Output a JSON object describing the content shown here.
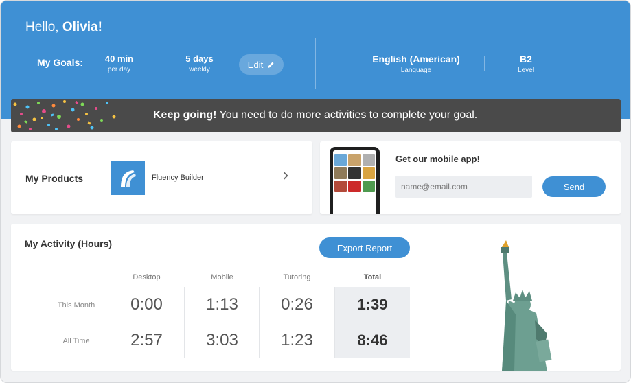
{
  "header": {
    "greeting_prefix": "Hello,",
    "user_name": "Olivia!"
  },
  "goals": {
    "label": "My Goals:",
    "time_value": "40 min",
    "time_sub": "per day",
    "days_value": "5 days",
    "days_sub": "weekly",
    "edit_label": "Edit",
    "language_value": "English (American)",
    "language_sub": "Language",
    "level_value": "B2",
    "level_sub": "Level"
  },
  "banner": {
    "bold": "Keep going!",
    "text": " You need to do more activities to complete your goal."
  },
  "products": {
    "title": "My Products",
    "item_name": "Fluency Builder"
  },
  "mobile_app": {
    "title": "Get our mobile app!",
    "email_placeholder": "name@email.com",
    "send_label": "Send"
  },
  "activity": {
    "title": "My Activity (Hours)",
    "export_label": "Export Report",
    "columns": [
      "Desktop",
      "Mobile",
      "Tutoring",
      "Total"
    ],
    "rows": [
      {
        "label": "This Month",
        "values": [
          "0:00",
          "1:13",
          "0:26",
          "1:39"
        ]
      },
      {
        "label": "All Time",
        "values": [
          "2:57",
          "3:03",
          "1:23",
          "8:46"
        ]
      }
    ]
  },
  "colors": {
    "brand_blue": "#3f90d4",
    "banner_dark": "#4a4a4a",
    "background": "#f1f2f4"
  }
}
